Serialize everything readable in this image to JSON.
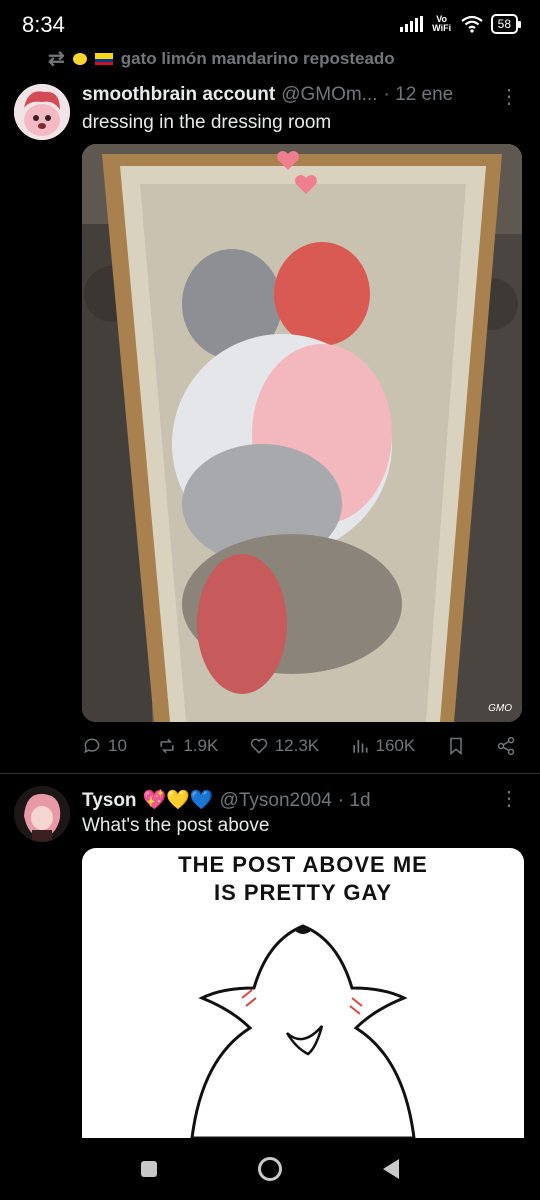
{
  "status_bar": {
    "time": "8:34",
    "network": "Vo WiFi",
    "battery": "58"
  },
  "repost": {
    "label": "gato limón mandarino reposteado",
    "flag_icon": "colombia-flag-icon",
    "emoji_icon": "lemon-icon"
  },
  "tweets": [
    {
      "name": "smoothbrain account",
      "handle": "@GMOm...",
      "time": "· 12 ene",
      "text": "dressing in the dressing room",
      "media_signature": "GMO",
      "stats": {
        "replies": "10",
        "reposts": "1.9K",
        "likes": "12.3K",
        "views": "160K"
      }
    },
    {
      "name": "Tyson",
      "name_emojis": "💖💛💙",
      "handle": "@Tyson2004",
      "time": "· 1d",
      "text": "What's the post above",
      "media_caption_1": "THE POST ABOVE ME",
      "media_caption_2": "IS PRETTY GAY"
    }
  ],
  "colors": {
    "background": "#000000",
    "text": "#e7e9ea",
    "muted": "#71767b",
    "divider": "#2f3336"
  }
}
